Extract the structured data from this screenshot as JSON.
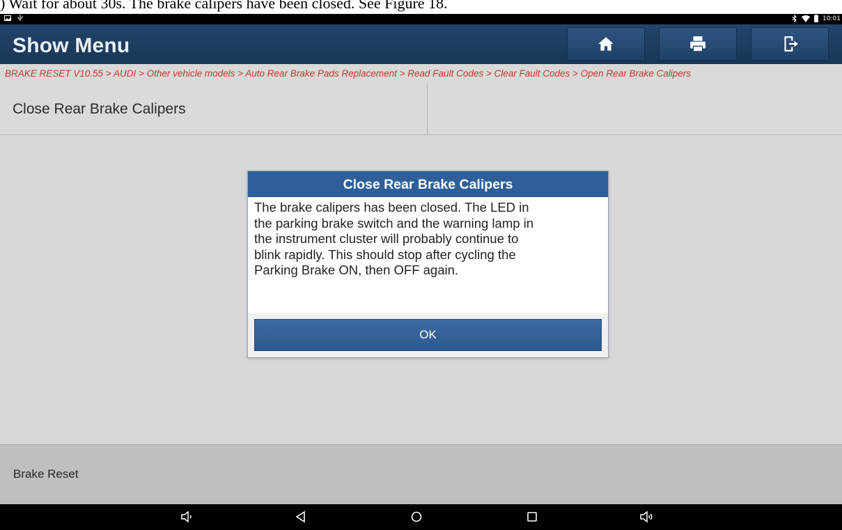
{
  "document": {
    "caption": ") Wait for about 30s. The brake calipers have been closed. See Figure 18."
  },
  "status_bar": {
    "left_icons": [
      "image-icon",
      "usb-icon"
    ],
    "right_icons": [
      "bluetooth-icon",
      "wifi-icon",
      "battery-icon"
    ],
    "time": "10:01"
  },
  "header": {
    "title": "Show Menu",
    "buttons": [
      "home-icon",
      "print-icon",
      "exit-icon"
    ]
  },
  "breadcrumb": "BRAKE RESET V10.55 > AUDI > Other vehicle models > Auto Rear Brake Pads Replacement > Read Fault Codes > Clear Fault Codes > Open Rear Brake Calipers",
  "page": {
    "title": "Close Rear Brake Calipers"
  },
  "dialog": {
    "title": "Close Rear Brake Calipers",
    "lines": [
      "The brake calipers has been closed. The LED in",
      "the parking brake switch and the warning lamp in",
      "the instrument cluster will probably continue to",
      "blink rapidly. This should stop after cycling the",
      "Parking Brake ON, then OFF again."
    ],
    "ok_label": "OK"
  },
  "footer": {
    "label": "Brake Reset"
  },
  "nav_bar": {
    "icons": [
      "volume-down-icon",
      "back-icon",
      "home-circle-icon",
      "recents-icon",
      "volume-up-icon"
    ]
  },
  "colors": {
    "header_bg": "#1f3e63",
    "breadcrumb_text": "#c8372d",
    "dialog_title_bg": "#2f5f98",
    "ok_button_bg": "#2f5f98"
  }
}
